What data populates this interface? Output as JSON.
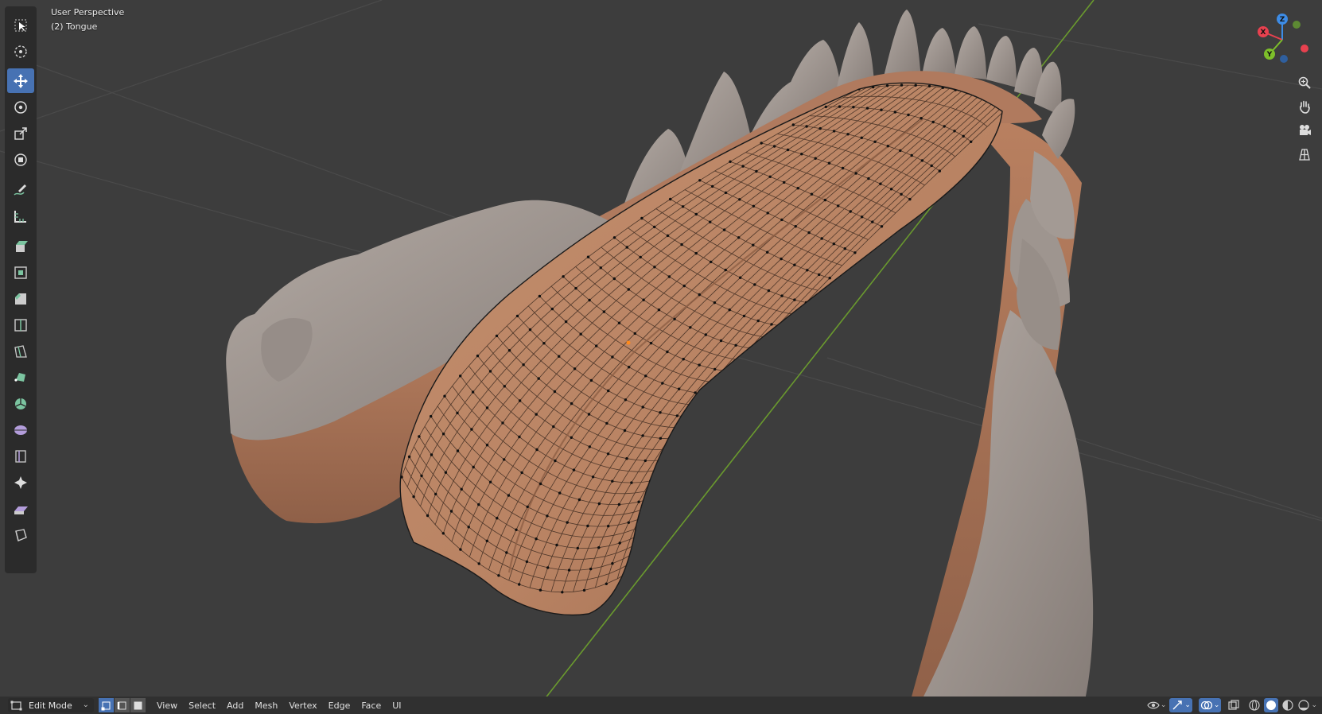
{
  "viewport": {
    "view_name": "User Perspective",
    "object_name": "(2) Tongue"
  },
  "toolbar": {
    "active_tool": "move",
    "tools": [
      {
        "icon": "select-box-icon"
      },
      {
        "icon": "cursor-icon"
      },
      {
        "icon": "move-icon"
      },
      {
        "icon": "rotate-icon"
      },
      {
        "icon": "scale-icon"
      },
      {
        "icon": "transform-icon"
      },
      {
        "icon": "annotate-icon"
      },
      {
        "icon": "measure-icon"
      },
      {
        "icon": "extrude-region-icon"
      },
      {
        "icon": "inset-faces-icon"
      },
      {
        "icon": "bevel-icon"
      },
      {
        "icon": "loop-cut-icon"
      },
      {
        "icon": "knife-icon"
      },
      {
        "icon": "poly-build-icon"
      },
      {
        "icon": "spin-icon"
      },
      {
        "icon": "smooth-icon"
      },
      {
        "icon": "edge-slide-icon"
      },
      {
        "icon": "shrink-fatten-icon"
      },
      {
        "icon": "shear-icon"
      },
      {
        "icon": "rip-region-icon"
      }
    ]
  },
  "gizmo": {
    "x_label": "X",
    "y_label": "Y",
    "z_label": "Z",
    "colors": {
      "x": "#e8414f",
      "y": "#7dbf2a",
      "z": "#3d8ce6"
    }
  },
  "nav_buttons": [
    "zoom-icon",
    "pan-hand-icon",
    "camera-icon",
    "grid-icon"
  ],
  "header": {
    "mode_label": "Edit Mode",
    "menus": [
      "View",
      "Select",
      "Add",
      "Mesh",
      "Vertex",
      "Edge",
      "Face",
      "UI"
    ]
  },
  "colors": {
    "background": "#3d3d3d",
    "accent": "#4772b3",
    "tongue": "#b98363",
    "teeth": "#a49b95",
    "gum": "#b07a5e",
    "y_axis_line": "#6a9a2e"
  }
}
